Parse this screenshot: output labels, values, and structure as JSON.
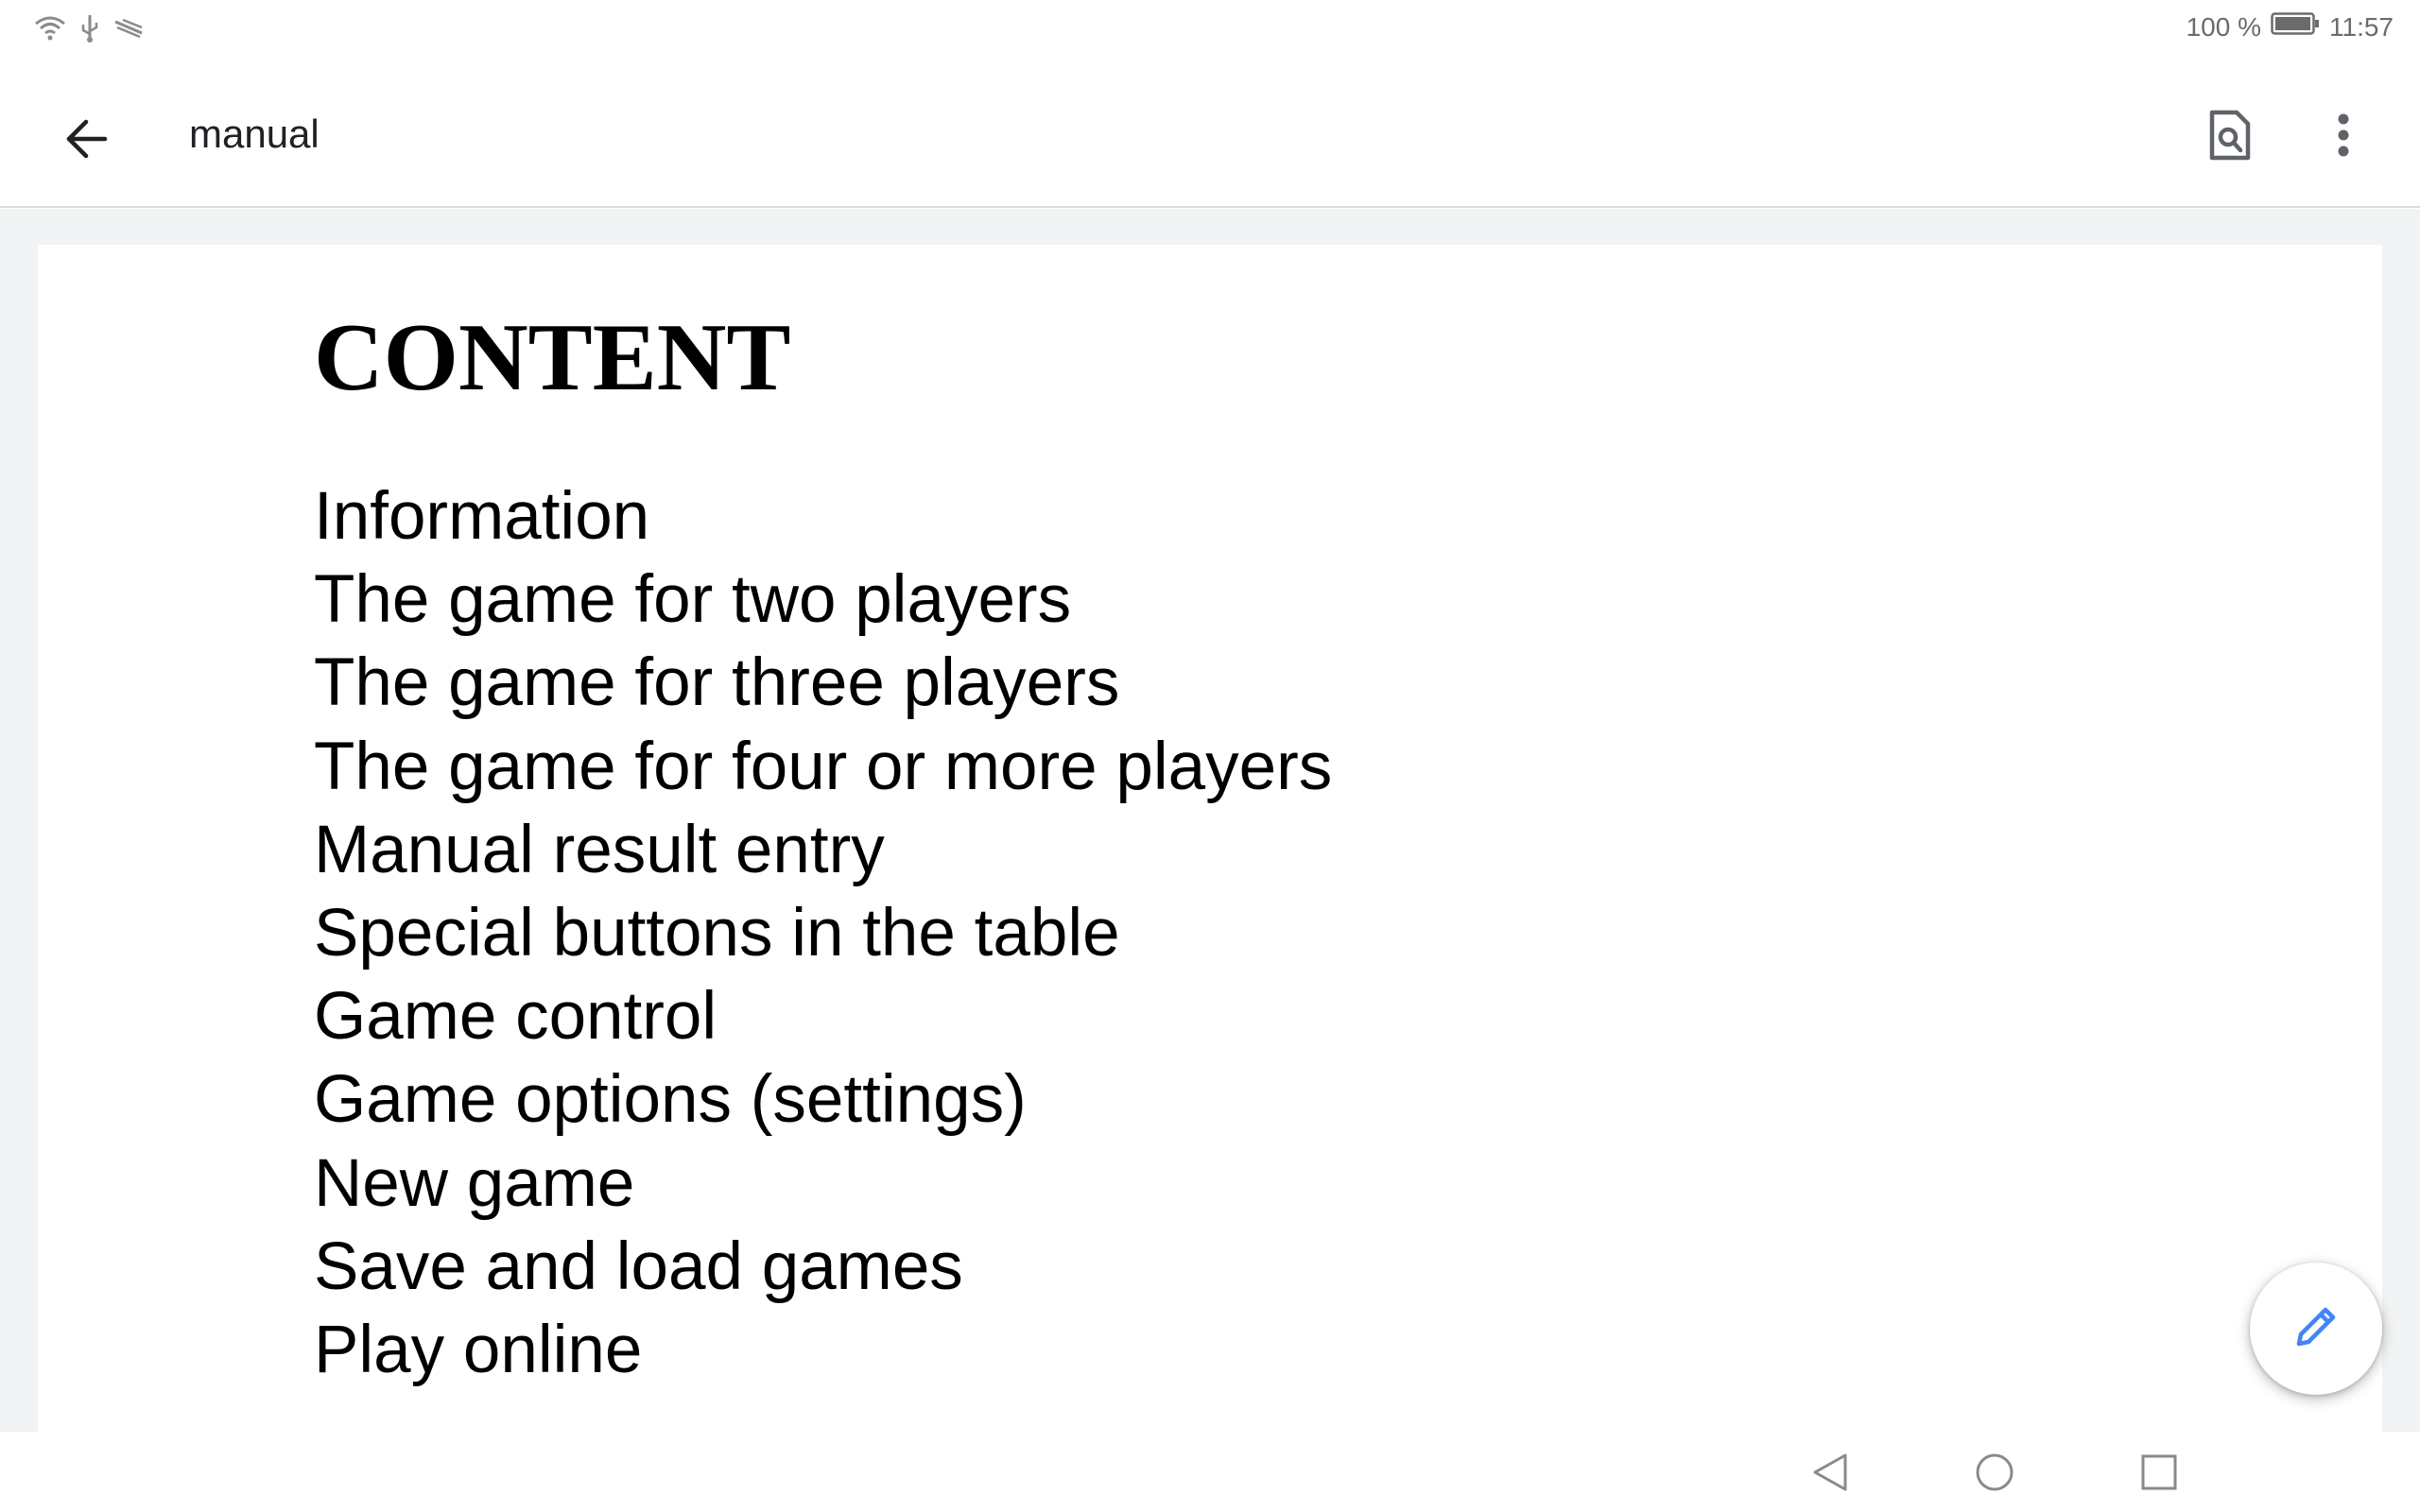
{
  "status_bar": {
    "battery_percent": "100 %",
    "time": "11:57",
    "icons": [
      "wifi-icon",
      "usb-icon",
      "cast-icon",
      "battery-icon"
    ]
  },
  "app_bar": {
    "title": "manual",
    "icons": [
      "back-arrow-icon",
      "find-in-page-icon",
      "more-vert-icon"
    ]
  },
  "document": {
    "heading": "CONTENT",
    "items": [
      "Information",
      "The game for two players",
      "The game for three players",
      "The game for four or more players",
      "Manual result entry",
      "Special buttons in the table",
      "Game control",
      "Game options (settings)",
      "New game",
      "Save and load games",
      "Play online"
    ]
  },
  "fab": {
    "icon": "pencil-icon",
    "color": "#4285f4"
  },
  "nav_bar": {
    "icons": [
      "nav-back-icon",
      "nav-home-icon",
      "nav-recents-icon"
    ]
  },
  "colors": {
    "text_primary": "#202124",
    "icon_gray": "#5f6368",
    "page_background": "#f1f3f4",
    "accent": "#4285f4"
  }
}
